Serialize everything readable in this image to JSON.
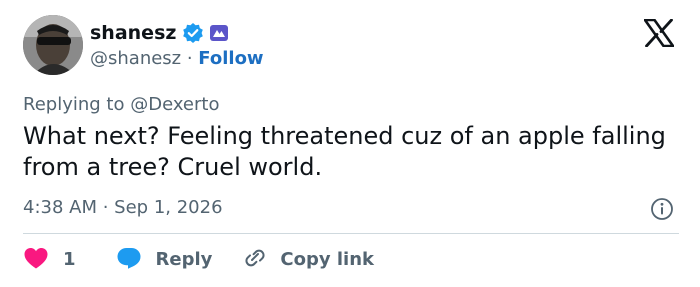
{
  "author": {
    "display_name": "shanesz",
    "handle": "@shanesz",
    "separator": " · ",
    "follow_label": "Follow",
    "verified_badge": "verified-check-icon",
    "affiliate_badge": "affiliate-badge-icon"
  },
  "platform_logo": "x-logo-icon",
  "tweet": {
    "replying_prefix": "Replying to ",
    "replying_to": "@Dexerto",
    "text": "What next? Feeling threatened cuz of an apple falling from a tree? Cruel world.",
    "time": "4:38 AM",
    "separator": " · ",
    "date": "Sep 1, 2026"
  },
  "actions": {
    "like_count": "1",
    "reply_label": "Reply",
    "copy_label": "Copy link"
  },
  "colors": {
    "verified": "#1d9bf0",
    "like": "#f91880",
    "reply": "#1d9bf0",
    "follow": "#1d6fc2",
    "secondary_text": "#536471"
  }
}
